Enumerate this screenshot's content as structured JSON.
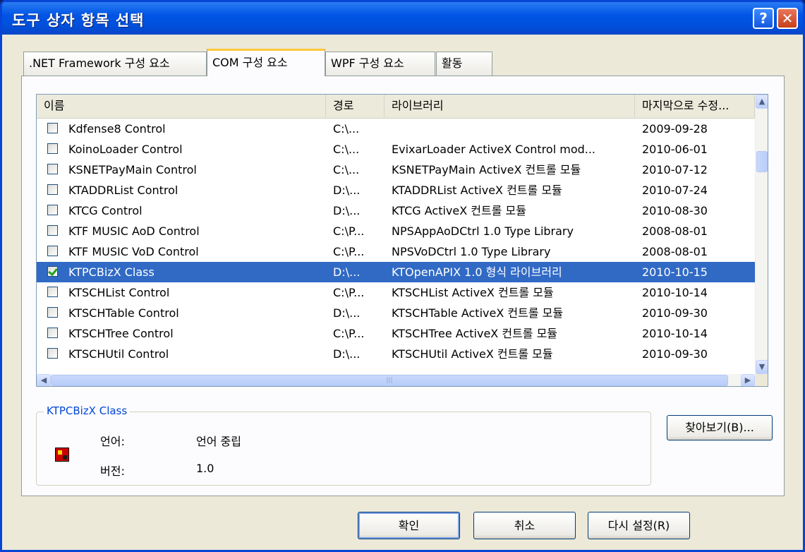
{
  "window": {
    "title": "도구 상자 항목 선택",
    "help_label": "?",
    "close_label": "✕"
  },
  "tabs": [
    {
      "label": ".NET Framework 구성 요소"
    },
    {
      "label": "COM 구성 요소",
      "active": true
    },
    {
      "label": "WPF 구성 요소"
    },
    {
      "label": "활동"
    }
  ],
  "list": {
    "columns": {
      "name": "이름",
      "path": "경로",
      "library": "라이브러리",
      "modified": "마지막으로 수정..."
    },
    "rows": [
      {
        "checked": false,
        "name": "Kdfense8 Control",
        "path": "C:\\...",
        "library": "",
        "date": "2009-09-28"
      },
      {
        "checked": false,
        "name": "KoinoLoader Control",
        "path": "C:\\...",
        "library": "EvixarLoader ActiveX Control mod...",
        "date": "2010-06-01"
      },
      {
        "checked": false,
        "name": "KSNETPayMain Control",
        "path": "C:\\...",
        "library": "KSNETPayMain ActiveX 컨트롤 모듈",
        "date": "2010-07-12"
      },
      {
        "checked": false,
        "name": "KTADDRList Control",
        "path": "D:\\...",
        "library": "KTADDRList ActiveX 컨트롤 모듈",
        "date": "2010-07-24"
      },
      {
        "checked": false,
        "name": "KTCG Control",
        "path": "D:\\...",
        "library": "KTCG ActiveX 컨트롤 모듈",
        "date": "2010-08-30"
      },
      {
        "checked": false,
        "name": "KTF MUSIC AoD Control",
        "path": "C:\\P...",
        "library": "NPSAppAoDCtrl 1.0 Type Library",
        "date": "2008-08-01"
      },
      {
        "checked": false,
        "name": "KTF MUSIC VoD Control",
        "path": "C:\\P...",
        "library": "NPSVoDCtrl 1.0 Type Library",
        "date": "2008-08-01"
      },
      {
        "checked": true,
        "selected": true,
        "name": "KTPCBizX Class",
        "path": "D:\\...",
        "library": "KTOpenAPIX 1.0 형식 라이브러리",
        "date": "2010-10-15"
      },
      {
        "checked": false,
        "name": "KTSCHList Control",
        "path": "C:\\P...",
        "library": "KTSCHList ActiveX 컨트롤 모듈",
        "date": "2010-10-14"
      },
      {
        "checked": false,
        "name": "KTSCHTable Control",
        "path": "D:\\...",
        "library": "KTSCHTable ActiveX 컨트롤 모듈",
        "date": "2010-09-30"
      },
      {
        "checked": false,
        "name": "KTSCHTree Control",
        "path": "C:\\P...",
        "library": "KTSCHTree ActiveX 컨트롤 모듈",
        "date": "2010-10-14"
      },
      {
        "checked": false,
        "name": "KTSCHUtil Control",
        "path": "D:\\...",
        "library": "KTSCHUtil ActiveX 컨트롤 모듈",
        "date": "2010-09-30"
      }
    ]
  },
  "details": {
    "title": "KTPCBizX Class",
    "language_label": "언어:",
    "language_value": "언어 중립",
    "version_label": "버전:",
    "version_value": "1.0"
  },
  "buttons": {
    "browse": "찾아보기(B)...",
    "ok": "확인",
    "cancel": "취소",
    "reset": "다시 설정(R)"
  }
}
